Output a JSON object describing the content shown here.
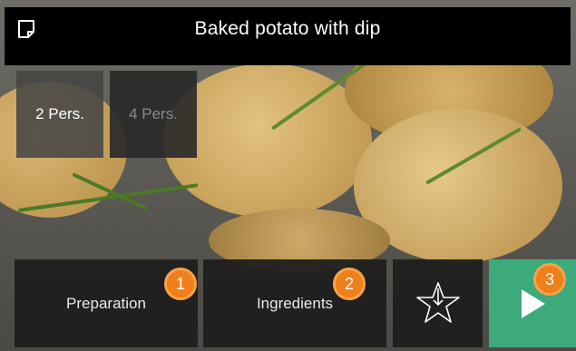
{
  "header": {
    "title": "Baked potato with dip",
    "note_icon": "note-icon"
  },
  "servings": {
    "options": [
      {
        "label": "2 Pers.",
        "selected": true
      },
      {
        "label": "4 Pers.",
        "selected": false
      }
    ]
  },
  "bottom_bar": {
    "preparation_label": "Preparation",
    "ingredients_label": "Ingredients",
    "favorite_icon": "star-arrow-down-icon",
    "play_icon": "play-icon"
  },
  "badges": [
    "1",
    "2",
    "3"
  ],
  "colors": {
    "accent_green": "#3caa7a",
    "badge_orange": "#ef7f1a",
    "topbar_bg": "#000000"
  }
}
